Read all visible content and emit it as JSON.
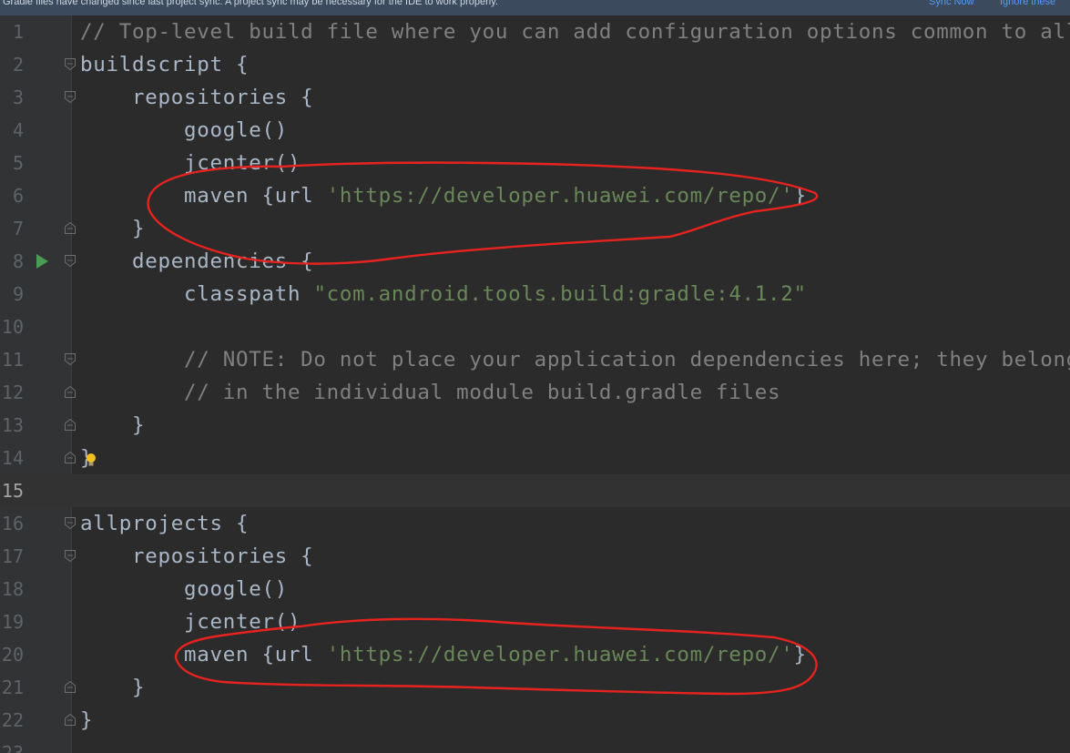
{
  "banner": {
    "message": "Gradle files have changed since last project sync. A project sync may be necessary for the IDE to work properly.",
    "sync_now": "Sync Now",
    "ignore": "Ignore these"
  },
  "editor": {
    "current_line": 15,
    "lines": [
      {
        "n": "1",
        "fold": "none",
        "segs": [
          {
            "t": "// Top-level build file where you can add configuration options common to all sub-projects/modules.",
            "c": "comment"
          }
        ]
      },
      {
        "n": "2",
        "fold": "open",
        "segs": [
          {
            "t": "buildscript {",
            "c": "plain"
          }
        ]
      },
      {
        "n": "3",
        "fold": "open",
        "segs": [
          {
            "t": "    repositories {",
            "c": "plain"
          }
        ]
      },
      {
        "n": "4",
        "fold": "none",
        "segs": [
          {
            "t": "        google()",
            "c": "plain"
          }
        ]
      },
      {
        "n": "5",
        "fold": "none",
        "segs": [
          {
            "t": "        jcenter()",
            "c": "plain"
          }
        ]
      },
      {
        "n": "6",
        "fold": "none",
        "segs": [
          {
            "t": "        maven {url ",
            "c": "plain"
          },
          {
            "t": "'https://developer.huawei.com/repo/'",
            "c": "str"
          },
          {
            "t": "}",
            "c": "plain"
          }
        ]
      },
      {
        "n": "7",
        "fold": "close",
        "segs": [
          {
            "t": "    }",
            "c": "plain"
          }
        ]
      },
      {
        "n": "8",
        "fold": "open",
        "run": true,
        "segs": [
          {
            "t": "    dependencies {",
            "c": "plain"
          }
        ]
      },
      {
        "n": "9",
        "fold": "none",
        "segs": [
          {
            "t": "        classpath ",
            "c": "plain"
          },
          {
            "t": "\"com.android.tools.build:gradle:4.1.2\"",
            "c": "str"
          }
        ]
      },
      {
        "n": "10",
        "fold": "none",
        "segs": []
      },
      {
        "n": "11",
        "fold": "open",
        "segs": [
          {
            "t": "        // NOTE: Do not place your application dependencies here; they belong",
            "c": "comment"
          }
        ]
      },
      {
        "n": "12",
        "fold": "close",
        "segs": [
          {
            "t": "        // in the individual module build.gradle files",
            "c": "comment"
          }
        ]
      },
      {
        "n": "13",
        "fold": "close",
        "segs": [
          {
            "t": "    }",
            "c": "plain"
          }
        ]
      },
      {
        "n": "14",
        "fold": "close",
        "bulb": true,
        "segs": [
          {
            "t": "}",
            "c": "plain"
          }
        ]
      },
      {
        "n": "15",
        "fold": "none",
        "segs": []
      },
      {
        "n": "16",
        "fold": "open",
        "segs": [
          {
            "t": "allprojects {",
            "c": "plain"
          }
        ]
      },
      {
        "n": "17",
        "fold": "open",
        "segs": [
          {
            "t": "    repositories {",
            "c": "plain"
          }
        ]
      },
      {
        "n": "18",
        "fold": "none",
        "segs": [
          {
            "t": "        google()",
            "c": "plain"
          }
        ]
      },
      {
        "n": "19",
        "fold": "none",
        "segs": [
          {
            "t": "        jcenter()",
            "c": "plain"
          }
        ]
      },
      {
        "n": "20",
        "fold": "none",
        "segs": [
          {
            "t": "        maven {url ",
            "c": "plain"
          },
          {
            "t": "'https://developer.huawei.com/repo/'",
            "c": "str"
          },
          {
            "t": "}",
            "c": "plain"
          }
        ]
      },
      {
        "n": "21",
        "fold": "close",
        "segs": [
          {
            "t": "    }",
            "c": "plain"
          }
        ]
      },
      {
        "n": "22",
        "fold": "close",
        "segs": [
          {
            "t": "}",
            "c": "plain"
          }
        ]
      },
      {
        "n": "23",
        "fold": "none",
        "segs": []
      }
    ]
  },
  "colors": {
    "background": "#2b2b2b",
    "gutter": "#313335",
    "code_text": "#a9b7c6",
    "comment": "#808080",
    "string": "#6a8759",
    "line_number": "#606366",
    "run_icon": "#499c54",
    "bulb": "#f0c020",
    "annotation_ink": "#e8231f"
  }
}
